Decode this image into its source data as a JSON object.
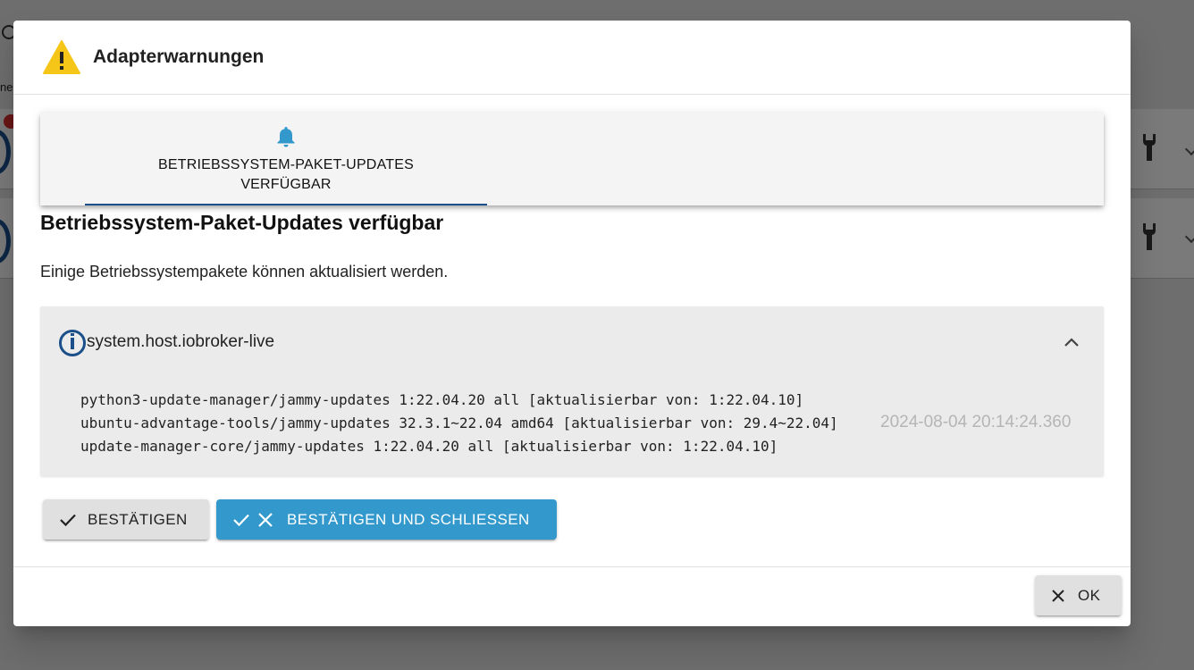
{
  "background": {
    "partial_text": "ne"
  },
  "dialog": {
    "title": "Adapterwarnungen",
    "tabs": [
      {
        "label": "BETRIEBSSYSTEM-PAKET-UPDATES VERFÜGBAR",
        "icon": "bell-icon",
        "selected": true
      }
    ],
    "section_title": "Betriebssystem-Paket-Updates verfügbar",
    "section_description": "Einige Betriebssystempakete können aktualisiert werden.",
    "panel": {
      "host": "system.host.iobroker-live",
      "packages": [
        "python3-update-manager/jammy-updates 1:22.04.20 all [aktualisierbar von: 1:22.04.10]",
        "ubuntu-advantage-tools/jammy-updates 32.3.1~22.04 amd64 [aktualisierbar von: 29.4~22.04]",
        "update-manager-core/jammy-updates 1:22.04.20 all [aktualisierbar von: 1:22.04.10]"
      ],
      "timestamp": "2024-08-04 20:14:24.360"
    },
    "buttons": {
      "confirm": "BESTÄTIGEN",
      "confirm_close": "BESTÄTIGEN UND SCHLIESSEN",
      "ok": "OK"
    },
    "colors": {
      "accent": "#3399cc",
      "warning": "#f5c518",
      "tab_indicator": "#1a4f8a",
      "bell": "#3399cc"
    }
  }
}
